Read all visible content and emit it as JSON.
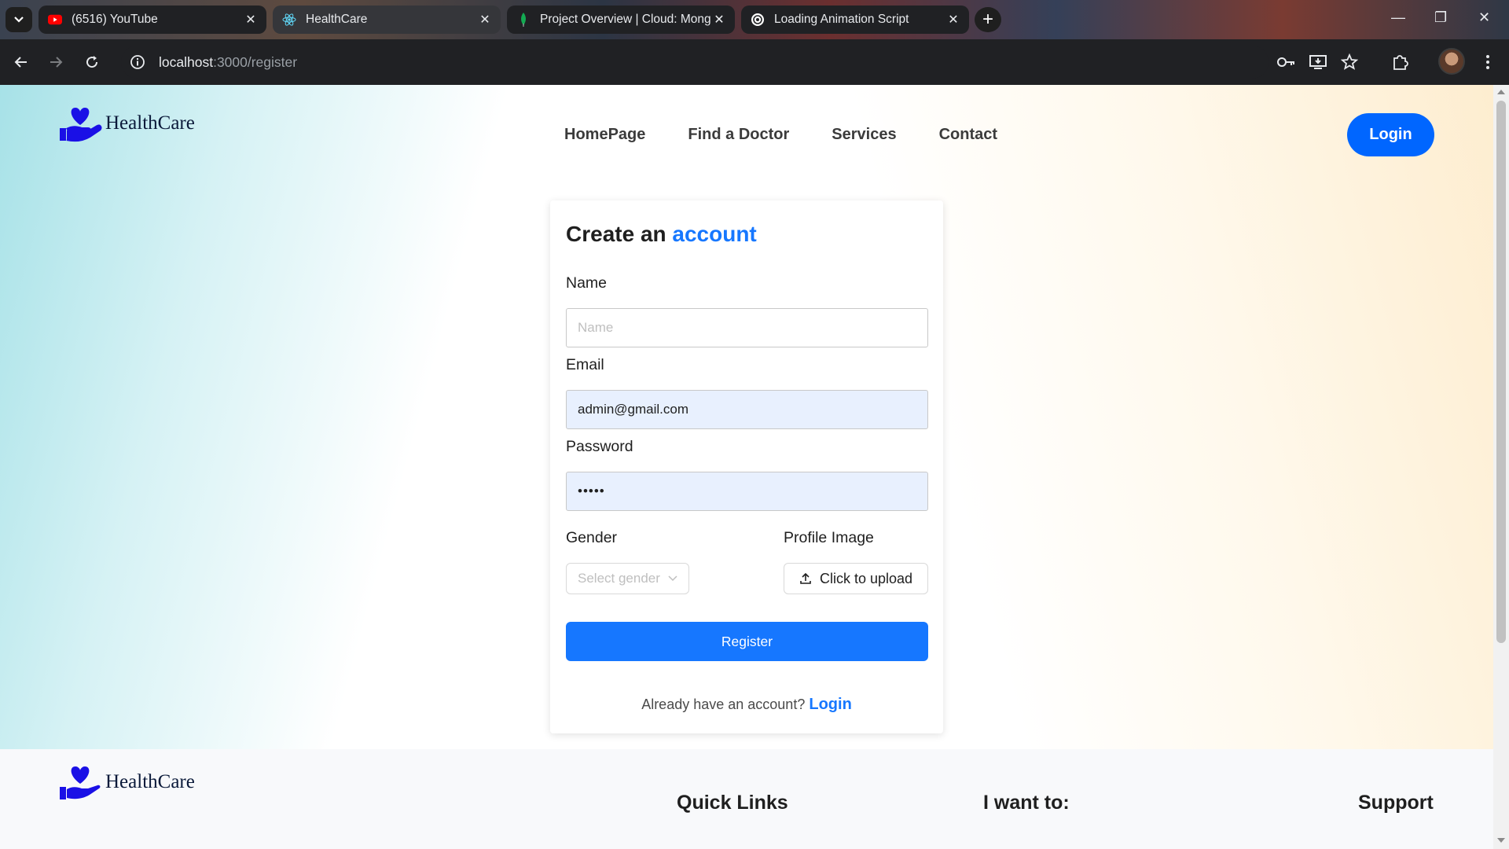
{
  "browser": {
    "tabs": [
      {
        "label": "(6516) YouTube",
        "icon": "youtube-icon",
        "active": false
      },
      {
        "label": "HealthCare",
        "icon": "react-icon",
        "active": true
      },
      {
        "label": "Project Overview | Cloud: Mong",
        "icon": "mongodb-leaf-icon",
        "active": false
      },
      {
        "label": "Loading Animation Script",
        "icon": "openai-icon",
        "active": false
      }
    ],
    "url_host": "localhost",
    "url_rest": ":3000/register"
  },
  "header": {
    "brand": "HealthCare",
    "nav": [
      "HomePage",
      "Find a Doctor",
      "Services",
      "Contact"
    ],
    "login_label": "Login"
  },
  "form": {
    "title_prefix": "Create an",
    "title_accent": "account",
    "name_label": "Name",
    "name_placeholder": "Name",
    "email_label": "Email",
    "email_value": "admin@gmail.com",
    "password_label": "Password",
    "password_mask": "•••••",
    "gender_label": "Gender",
    "gender_placeholder": "Select gender",
    "profile_label": "Profile Image",
    "upload_label": "Click to upload",
    "register_label": "Register",
    "already_text": "Already have an account?",
    "already_link": "Login"
  },
  "footer": {
    "brand": "HealthCare",
    "headings": [
      "Quick Links",
      "I want to:",
      "Support"
    ]
  },
  "colors": {
    "primary": "#1677ff",
    "nav_login": "#0066ff",
    "brand_blue": "#1a10e6"
  }
}
